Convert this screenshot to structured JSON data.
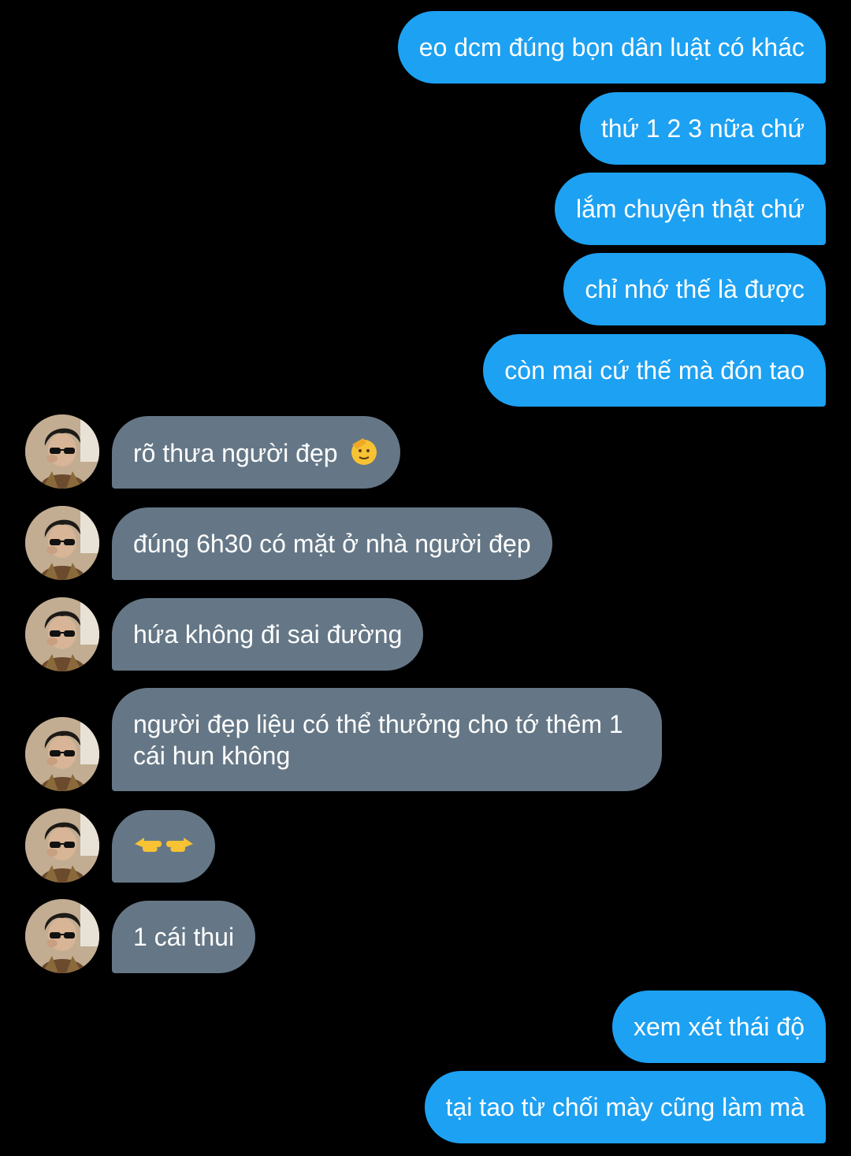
{
  "messages": [
    {
      "dir": "out",
      "text": "eo dcm đúng bọn dân luật có khác"
    },
    {
      "dir": "out",
      "text": "thứ 1 2 3 nữa chứ"
    },
    {
      "dir": "out",
      "text": "lắm chuyện thật chứ"
    },
    {
      "dir": "out",
      "text": "chỉ nhớ thế là được"
    },
    {
      "dir": "out",
      "text": "còn mai cứ thế mà đón tao"
    },
    {
      "dir": "in",
      "text": "rõ thưa người đẹp",
      "emoji": "saluting-face-emoji"
    },
    {
      "dir": "in",
      "text": "đúng 6h30 có mặt ở nhà người đẹp"
    },
    {
      "dir": "in",
      "text": "hứa không đi sai đường"
    },
    {
      "dir": "in",
      "text": "người đẹp liệu có thể thưởng cho tớ thêm 1 cái hun không"
    },
    {
      "dir": "in",
      "text": "",
      "emoji": "pointing-fingers-emoji"
    },
    {
      "dir": "in",
      "text": "1 cái thui"
    },
    {
      "dir": "out",
      "text": "xem xét thái độ"
    },
    {
      "dir": "out",
      "text": "tại tao từ chối mày cũng làm mà"
    }
  ],
  "colors": {
    "background": "#000000",
    "outgoing_bubble": "#1da1f2",
    "incoming_bubble": "#657786",
    "text": "#ffffff"
  },
  "icons": {
    "avatar": "user-avatar",
    "emoji_1": "saluting-face-emoji",
    "emoji_2": "pointing-fingers-emoji"
  }
}
